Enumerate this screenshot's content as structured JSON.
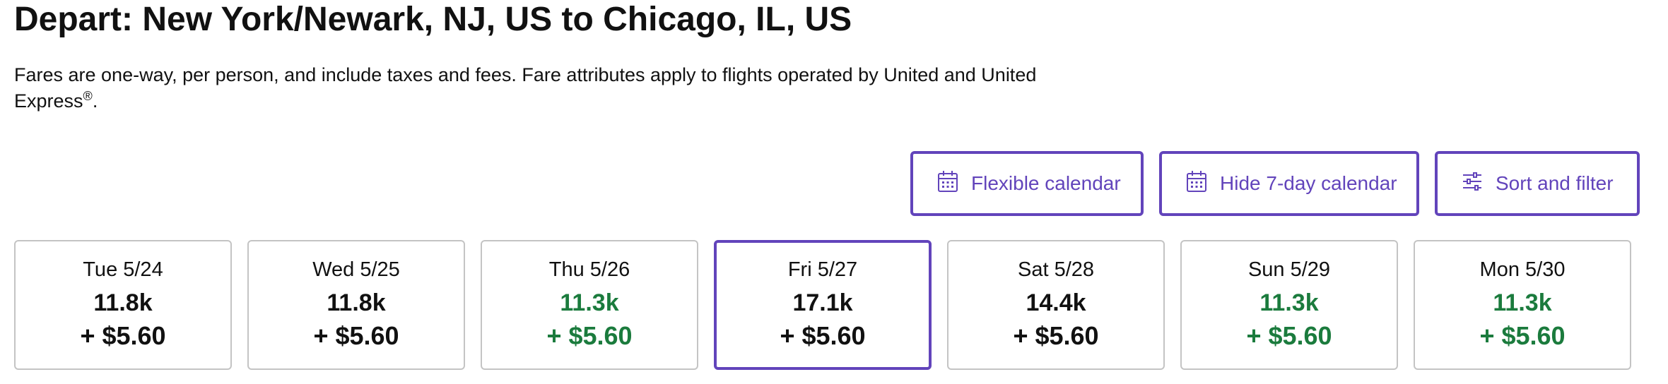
{
  "header": {
    "title": "Depart: New York/Newark, NJ, US to Chicago, IL, US",
    "disclaimer": "Fares are one-way, per person, and include taxes and fees. Fare attributes apply to flights operated by United and United Express",
    "disclaimer_mark": "®",
    "disclaimer_end": "."
  },
  "actions": {
    "flexible_calendar": "Flexible calendar",
    "hide_calendar": "Hide 7-day calendar",
    "sort_filter": "Sort and filter"
  },
  "colors": {
    "accent": "#6244bb",
    "low_fare": "#1b7b3d",
    "border": "#c4c4c4"
  },
  "days": [
    {
      "date": "Tue 5/24",
      "miles": "11.8k",
      "tax": "+ $5.60",
      "low": false,
      "selected": false
    },
    {
      "date": "Wed 5/25",
      "miles": "11.8k",
      "tax": "+ $5.60",
      "low": false,
      "selected": false
    },
    {
      "date": "Thu 5/26",
      "miles": "11.3k",
      "tax": "+ $5.60",
      "low": true,
      "selected": false
    },
    {
      "date": "Fri 5/27",
      "miles": "17.1k",
      "tax": "+ $5.60",
      "low": false,
      "selected": true
    },
    {
      "date": "Sat 5/28",
      "miles": "14.4k",
      "tax": "+ $5.60",
      "low": false,
      "selected": false
    },
    {
      "date": "Sun 5/29",
      "miles": "11.3k",
      "tax": "+ $5.60",
      "low": true,
      "selected": false
    },
    {
      "date": "Mon 5/30",
      "miles": "11.3k",
      "tax": "+ $5.60",
      "low": true,
      "selected": false
    }
  ]
}
